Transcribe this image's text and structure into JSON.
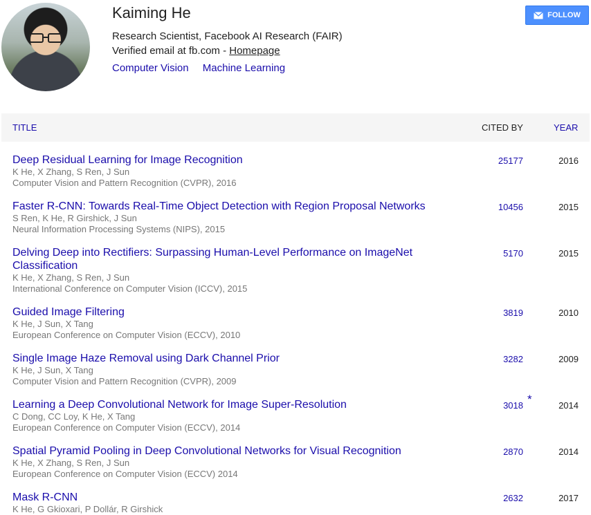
{
  "profile": {
    "name": "Kaiming He",
    "affiliation": "Research Scientist, Facebook AI Research (FAIR)",
    "verified_prefix": "Verified email at fb.com - ",
    "homepage_label": "Homepage",
    "interests": [
      "Computer Vision",
      "Machine Learning"
    ],
    "follow_label": "FOLLOW"
  },
  "table": {
    "col_title": "TITLE",
    "col_cited": "CITED BY",
    "col_year": "YEAR",
    "rows": [
      {
        "title": "Deep Residual Learning for Image Recognition",
        "authors": "K He, X Zhang, S Ren, J Sun",
        "venue": "Computer Vision and Pattern Recognition (CVPR), 2016",
        "cited": "25177",
        "year": "2016"
      },
      {
        "title": "Faster R-CNN: Towards Real-Time Object Detection with Region Proposal Networks",
        "authors": "S Ren, K He, R Girshick, J Sun",
        "venue": "Neural Information Processing Systems (NIPS), 2015",
        "cited": "10456",
        "year": "2015"
      },
      {
        "title": "Delving Deep into Rectifiers: Surpassing Human-Level Performance on ImageNet Classification",
        "authors": "K He, X Zhang, S Ren, J Sun",
        "venue": "International Conference on Computer Vision (ICCV), 2015",
        "cited": "5170",
        "year": "2015"
      },
      {
        "title": "Guided Image Filtering",
        "authors": "K He, J Sun, X Tang",
        "venue": "European Conference on Computer Vision (ECCV), 2010",
        "cited": "3819",
        "year": "2010"
      },
      {
        "title": "Single Image Haze Removal using Dark Channel Prior",
        "authors": "K He, J Sun, X Tang",
        "venue": "Computer Vision and Pattern Recognition (CVPR), 2009",
        "cited": "3282",
        "year": "2009"
      },
      {
        "title": "Learning a Deep Convolutional Network for Image Super-Resolution",
        "authors": "C Dong, CC Loy, K He, X Tang",
        "venue": "European Conference on Computer Vision (ECCV), 2014",
        "cited": "3018",
        "year": "2014",
        "star": "*"
      },
      {
        "title": "Spatial Pyramid Pooling in Deep Convolutional Networks for Visual Recognition",
        "authors": "K He, X Zhang, S Ren, J Sun",
        "venue": "European Conference on Computer Vision (ECCV) 2014",
        "cited": "2870",
        "year": "2014"
      },
      {
        "title": "Mask R-CNN",
        "authors": "K He, G Gkioxari, P Dollár, R Girshick",
        "venue": "",
        "cited": "2632",
        "year": "2017"
      }
    ]
  },
  "colors": {
    "link": "#1a0dab",
    "muted": "#777777",
    "follow_bg": "#4d90fe",
    "header_bg": "#f5f5f5"
  },
  "icons": {
    "follow": "envelope-icon"
  }
}
